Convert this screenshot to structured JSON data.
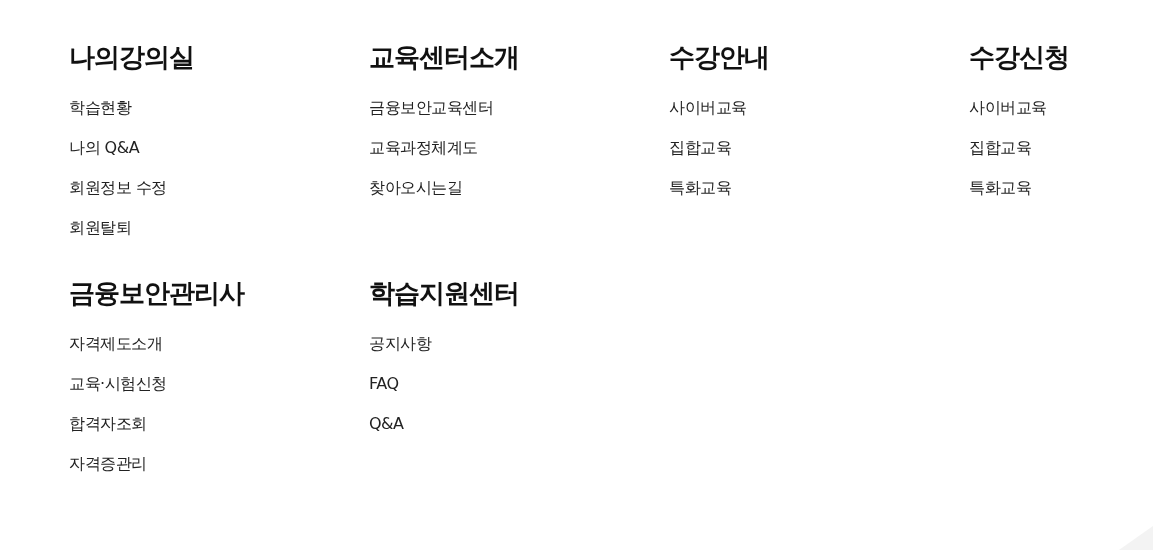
{
  "menu_sections": [
    {
      "title": "나의강의실",
      "links": [
        "학습현황",
        "나의 Q&A",
        "회원정보 수정",
        "회원탈퇴"
      ]
    },
    {
      "title": "교육센터소개",
      "links": [
        "금융보안교육센터",
        "교육과정체계도",
        "찾아오시는길"
      ]
    },
    {
      "title": "수강안내",
      "links": [
        "사이버교육",
        "집합교육",
        "특화교육"
      ]
    },
    {
      "title": "수강신청",
      "links": [
        "사이버교육",
        "집합교육",
        "특화교육"
      ]
    },
    {
      "title": "금융보안관리사",
      "links": [
        "자격제도소개",
        "교육·시험신청",
        "합격자조회",
        "자격증관리"
      ]
    },
    {
      "title": "학습지원센터",
      "links": [
        "공지사항",
        "FAQ",
        "Q&A"
      ]
    }
  ]
}
